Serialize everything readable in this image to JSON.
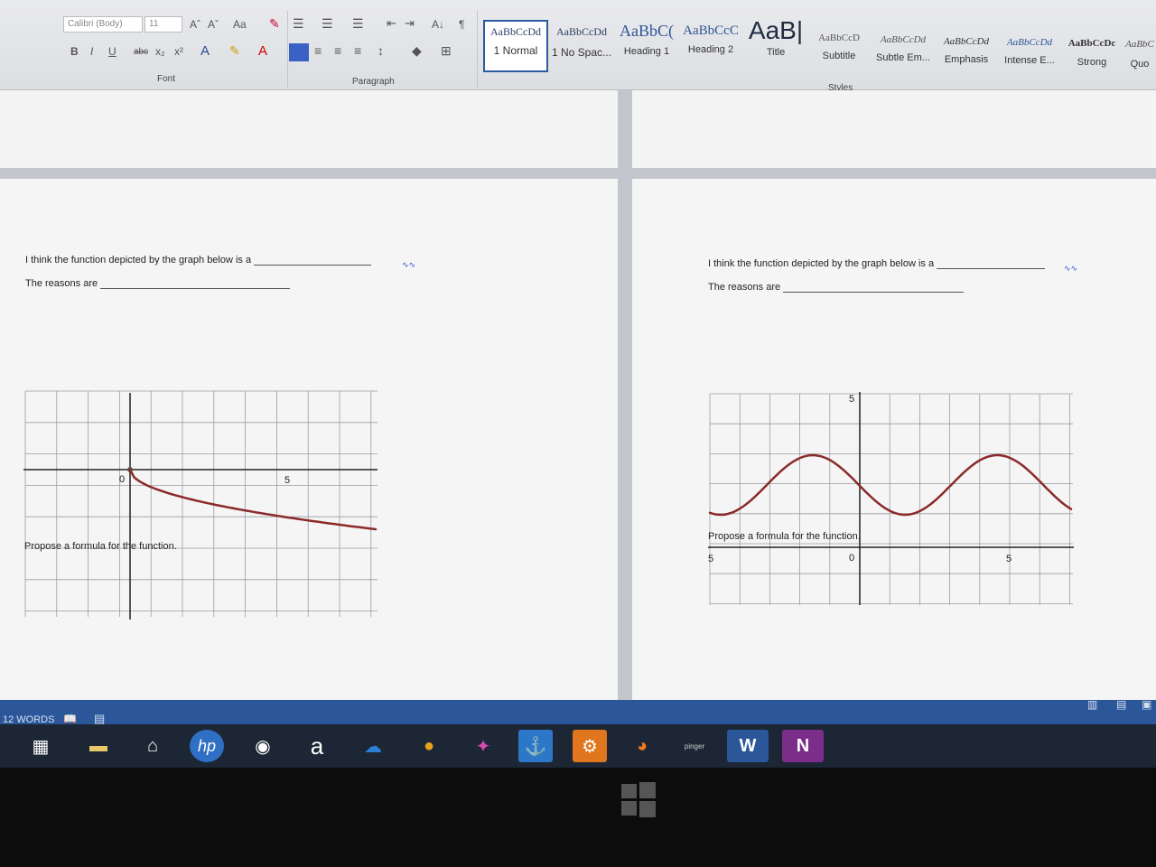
{
  "ribbon": {
    "font_name": "Calibri (Body)",
    "font_size": "11",
    "font_group_label": "Font",
    "paragraph_group_label": "Paragraph",
    "styles_group_label": "Styles",
    "buttons": {
      "grow_font": "Aˆ",
      "shrink_font": "Aˇ",
      "change_case": "Aa",
      "bold": "B",
      "italic": "I",
      "underline": "U",
      "strikethrough": "abc",
      "subscript": "x₂",
      "superscript": "x²",
      "sort": "A↓",
      "show_marks": "¶"
    },
    "styles": [
      {
        "preview": "AaBbCcDd",
        "name": "1 Normal"
      },
      {
        "preview": "AaBbCcDd",
        "name": "1 No Spac..."
      },
      {
        "preview": "AaBbC(",
        "name": "Heading 1"
      },
      {
        "preview": "AaBbCcC",
        "name": "Heading 2"
      },
      {
        "preview": "AaB|",
        "name": "Title"
      },
      {
        "preview": "AaBbCcD",
        "name": "Subtitle"
      },
      {
        "preview": "AaBbCcDd",
        "name": "Subtle Em..."
      },
      {
        "preview": "AaBbCcDd",
        "name": "Emphasis"
      },
      {
        "preview": "AaBbCcDd",
        "name": "Intense E..."
      },
      {
        "preview": "AaBbCcDc",
        "name": "Strong"
      },
      {
        "preview": "AaBbC",
        "name": "Quo"
      }
    ]
  },
  "pages": [
    {
      "question": "I think the function depicted by the graph below is a",
      "reasons": "The reasons are",
      "propose": "Propose a formula for the function.",
      "origin_label": "0",
      "tick_label": "5"
    },
    {
      "question": "I think the function depicted by the graph below is a",
      "reasons": "The reasons are",
      "propose": "Propose a formula for the function.",
      "origin_label": "0",
      "tick_label_right": "5",
      "tick_label_left": "5",
      "tick_label_top": "5"
    }
  ],
  "status_bar": {
    "word_count": "12 WORDS"
  },
  "taskbar": {
    "items": [
      {
        "name": "store",
        "glyph": "▦"
      },
      {
        "name": "file-explorer",
        "glyph": "▬"
      },
      {
        "name": "home",
        "glyph": "⌂"
      },
      {
        "name": "hp",
        "glyph": "hp"
      },
      {
        "name": "media",
        "glyph": "◉"
      },
      {
        "name": "amazon",
        "glyph": "a"
      },
      {
        "name": "onedrive",
        "glyph": "☁"
      },
      {
        "name": "chrome",
        "glyph": "●"
      },
      {
        "name": "puzzle",
        "glyph": "✦"
      },
      {
        "name": "dock",
        "glyph": "⚓"
      },
      {
        "name": "settings",
        "glyph": "⚙"
      },
      {
        "name": "firefox",
        "glyph": "◕"
      },
      {
        "name": "pinger",
        "glyph": "pinger"
      },
      {
        "name": "word",
        "glyph": "W"
      },
      {
        "name": "onenote",
        "glyph": "N"
      }
    ]
  },
  "colors": {
    "curve": "#8b2a2a",
    "ribbon_bg": "#e6e7ea",
    "statusbar": "#2b579a",
    "taskbar": "#1c2634"
  }
}
